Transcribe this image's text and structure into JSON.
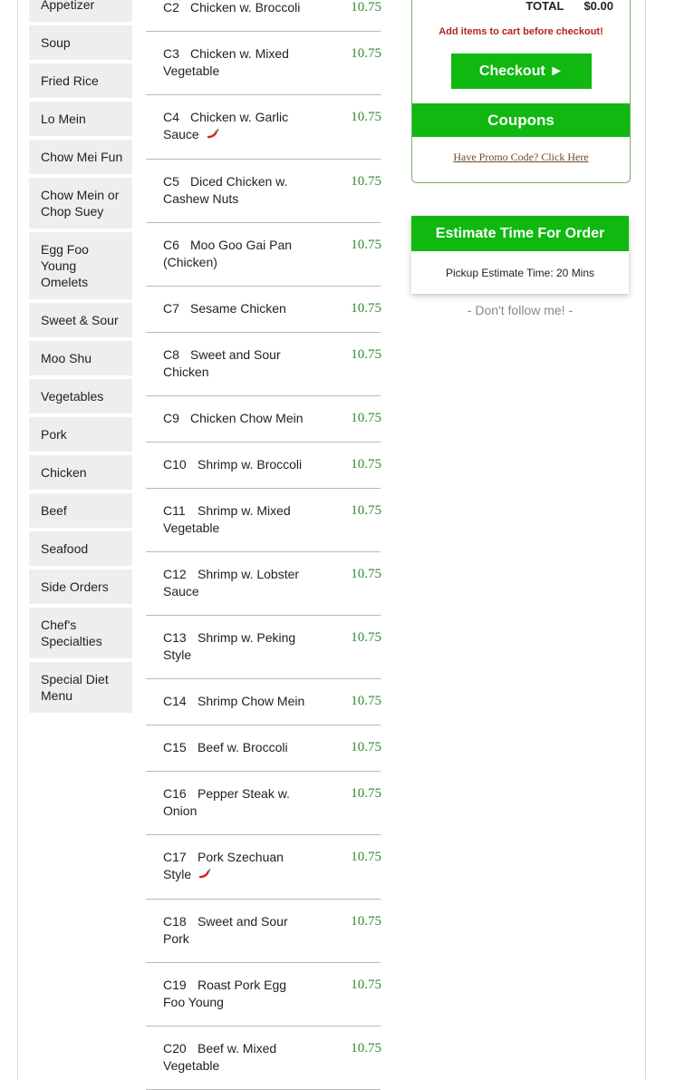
{
  "categories": [
    "Appetizer",
    "Soup",
    "Fried Rice",
    "Lo Mein",
    "Chow Mei Fun",
    "Chow Mein or Chop Suey",
    "Egg Foo Young Omelets",
    "Sweet & Sour",
    "Moo Shu",
    "Vegetables",
    "Pork",
    "Chicken",
    "Beef",
    "Seafood",
    "Side Orders",
    "Chef's Specialties",
    "Special Diet Menu"
  ],
  "menu_items": [
    {
      "code": "C2",
      "name": "Chicken w. Broccoli",
      "price": "10.75",
      "spicy": false
    },
    {
      "code": "C3",
      "name": "Chicken w. Mixed Vegetable",
      "price": "10.75",
      "spicy": false
    },
    {
      "code": "C4",
      "name": "Chicken w. Garlic Sauce",
      "price": "10.75",
      "spicy": true
    },
    {
      "code": "C5",
      "name": "Diced Chicken w. Cashew Nuts",
      "price": "10.75",
      "spicy": false
    },
    {
      "code": "C6",
      "name": "Moo Goo Gai Pan (Chicken)",
      "price": "10.75",
      "spicy": false
    },
    {
      "code": "C7",
      "name": "Sesame Chicken",
      "price": "10.75",
      "spicy": false
    },
    {
      "code": "C8",
      "name": "Sweet and Sour Chicken",
      "price": "10.75",
      "spicy": false
    },
    {
      "code": "C9",
      "name": "Chicken Chow Mein",
      "price": "10.75",
      "spicy": false
    },
    {
      "code": "C10",
      "name": "Shrimp w. Broccoli",
      "price": "10.75",
      "spicy": false
    },
    {
      "code": "C11",
      "name": "Shrimp w. Mixed Vegetable",
      "price": "10.75",
      "spicy": false
    },
    {
      "code": "C12",
      "name": "Shrimp w. Lobster Sauce",
      "price": "10.75",
      "spicy": false
    },
    {
      "code": "C13",
      "name": "Shrimp w. Peking Style",
      "price": "10.75",
      "spicy": false
    },
    {
      "code": "C14",
      "name": "Shrimp Chow Mein",
      "price": "10.75",
      "spicy": false
    },
    {
      "code": "C15",
      "name": "Beef w. Broccoli",
      "price": "10.75",
      "spicy": false
    },
    {
      "code": "C16",
      "name": "Pepper Steak w. Onion",
      "price": "10.75",
      "spicy": false
    },
    {
      "code": "C17",
      "name": "Pork Szechuan Style",
      "price": "10.75",
      "spicy": true
    },
    {
      "code": "C18",
      "name": "Sweet and Sour Pork",
      "price": "10.75",
      "spicy": false
    },
    {
      "code": "C19",
      "name": "Roast Pork Egg Foo Young",
      "price": "10.75",
      "spicy": false
    },
    {
      "code": "C20",
      "name": "Beef w. Mixed Vegetable",
      "price": "10.75",
      "spicy": false
    }
  ],
  "cart": {
    "total_label": "TOTAL",
    "total_value": "$0.00",
    "message": "Add items to cart before checkout!",
    "checkout_label": "Checkout ►"
  },
  "coupons": {
    "title": "Coupons",
    "promo_link": "Have Promo Code? Click Here"
  },
  "estimate": {
    "title": "Estimate Time For Order",
    "text": "Pickup Estimate Time: 20 Mins"
  },
  "follow_note": "- Don't follow me! -",
  "colors": {
    "accent_green": "#10b810",
    "price_green": "#2e8b2e",
    "cart_message_red": "#b22222",
    "category_bg": "#eeeeee"
  }
}
